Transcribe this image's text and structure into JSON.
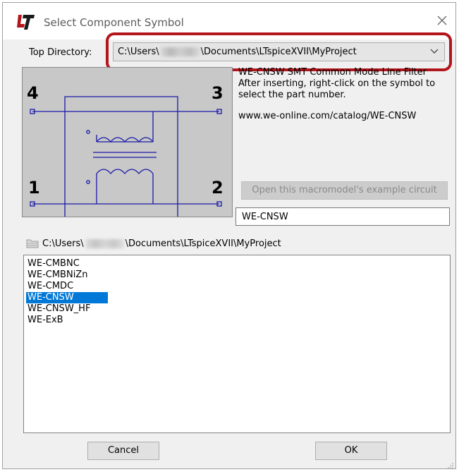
{
  "window": {
    "title": "Select Component Symbol",
    "app_icon": "ltspice-logo-icon",
    "close_icon": "close-icon"
  },
  "top_directory": {
    "label": "Top Directory:",
    "value_prefix": "C:\\Users\\",
    "value_suffix": "\\Documents\\LTspiceXVII\\MyProject",
    "redacted": "user-name-blurred",
    "dropdown_icon": "chevron-down-icon"
  },
  "preview": {
    "pin_labels": [
      "4",
      "3",
      "1",
      "2"
    ]
  },
  "info": {
    "line1": "WE-CNSW SMT Common Mode Line Filter",
    "line2": "After inserting, right-click on the symbol to",
    "line3": "select the part number.",
    "url": "www.we-online.com/catalog/WE-CNSW"
  },
  "example_button": "Open this macromodel's example circuit",
  "component_name": "WE-CNSW",
  "current_path": {
    "folder_icon": "folder-icon",
    "prefix": "C:\\Users\\",
    "suffix": "\\Documents\\LTspiceXVII\\MyProject"
  },
  "list": {
    "items": [
      "WE-CMBNC",
      "WE-CMBNiZn",
      "WE-CMDC",
      "WE-CNSW",
      "WE-CNSW_HF",
      "WE-ExB"
    ],
    "selected": "WE-CNSW"
  },
  "buttons": {
    "cancel": "Cancel",
    "ok": "OK"
  },
  "colors": {
    "highlight": "#b3151c",
    "selection": "#0078d7",
    "symbol": "#1a1aa8"
  }
}
